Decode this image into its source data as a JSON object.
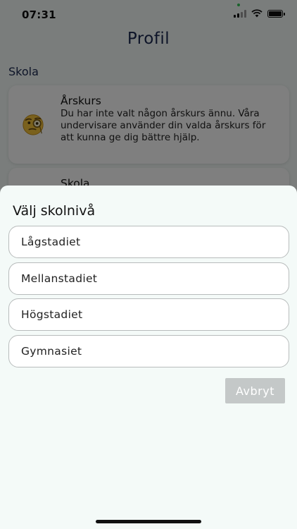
{
  "status_bar": {
    "time": "07:31"
  },
  "page": {
    "title": "Profil",
    "section_heading": "Skola"
  },
  "cards": [
    {
      "title": "Årskurs",
      "text": "Du har inte valt någon årskurs ännu. Våra undervisare använder din valda årskurs för att kunna ge dig bättre hjälp.",
      "icon": "monocle-face-icon"
    },
    {
      "title": "Skola"
    }
  ],
  "sheet": {
    "title": "Välj skolnivå",
    "options": [
      "Lågstadiet",
      "Mellanstadiet",
      "Högstadiet",
      "Gymnasiet"
    ],
    "cancel_label": "Avbryt"
  },
  "colors": {
    "title_navy": "#1b2950",
    "sheet_background": "#f4faf8",
    "cancel_button": "#c4c8c8",
    "option_border": "#b8bcbc"
  }
}
